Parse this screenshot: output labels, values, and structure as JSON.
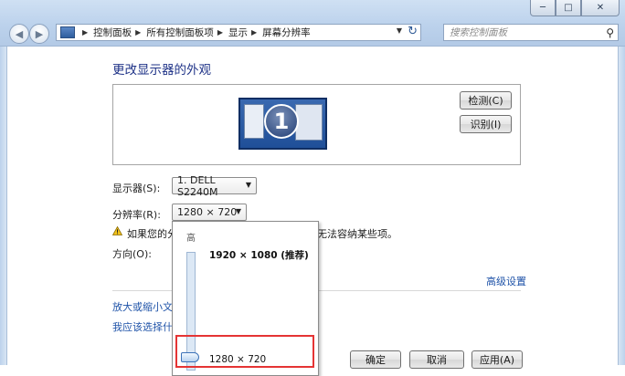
{
  "window": {
    "minimize_glyph": "─",
    "maximize_glyph": "□",
    "close_glyph": "✕"
  },
  "nav": {
    "back_glyph": "◀",
    "forward_glyph": "▶"
  },
  "address": {
    "crumbs": [
      "控制面板",
      "所有控制面板项",
      "显示",
      "屏幕分辨率"
    ],
    "separator": "▶",
    "dropdown_glyph": "▼",
    "refresh_glyph": "↻"
  },
  "search": {
    "placeholder": "搜索控制面板",
    "icon_glyph": "⚲"
  },
  "main": {
    "title": "更改显示器的外观",
    "monitor_number": "1",
    "detect_button": "检测(C)",
    "identify_button": "识别(I)",
    "display_label": "显示器(S):",
    "display_value": "1. DELL S2240M",
    "resolution_label": "分辨率(R):",
    "resolution_value": "1280 × 720",
    "warning_text_left": "如果您的分",
    "warning_text_right": "无法容纳某些项。",
    "orientation_label": "方向(O):",
    "advanced_link": "高级设置",
    "link1": "放大或缩小文本",
    "link2": "我应该选择什么",
    "ok_button": "确定",
    "cancel_button": "取消",
    "apply_button": "应用(A)"
  },
  "popup": {
    "high_label": "高",
    "option_top": "1920 × 1080 (推荐)",
    "option_selected": "1280 × 720"
  },
  "colors": {
    "title_blue": "#1e3287",
    "link_blue": "#1f53a8",
    "highlight_red": "#e53434"
  }
}
